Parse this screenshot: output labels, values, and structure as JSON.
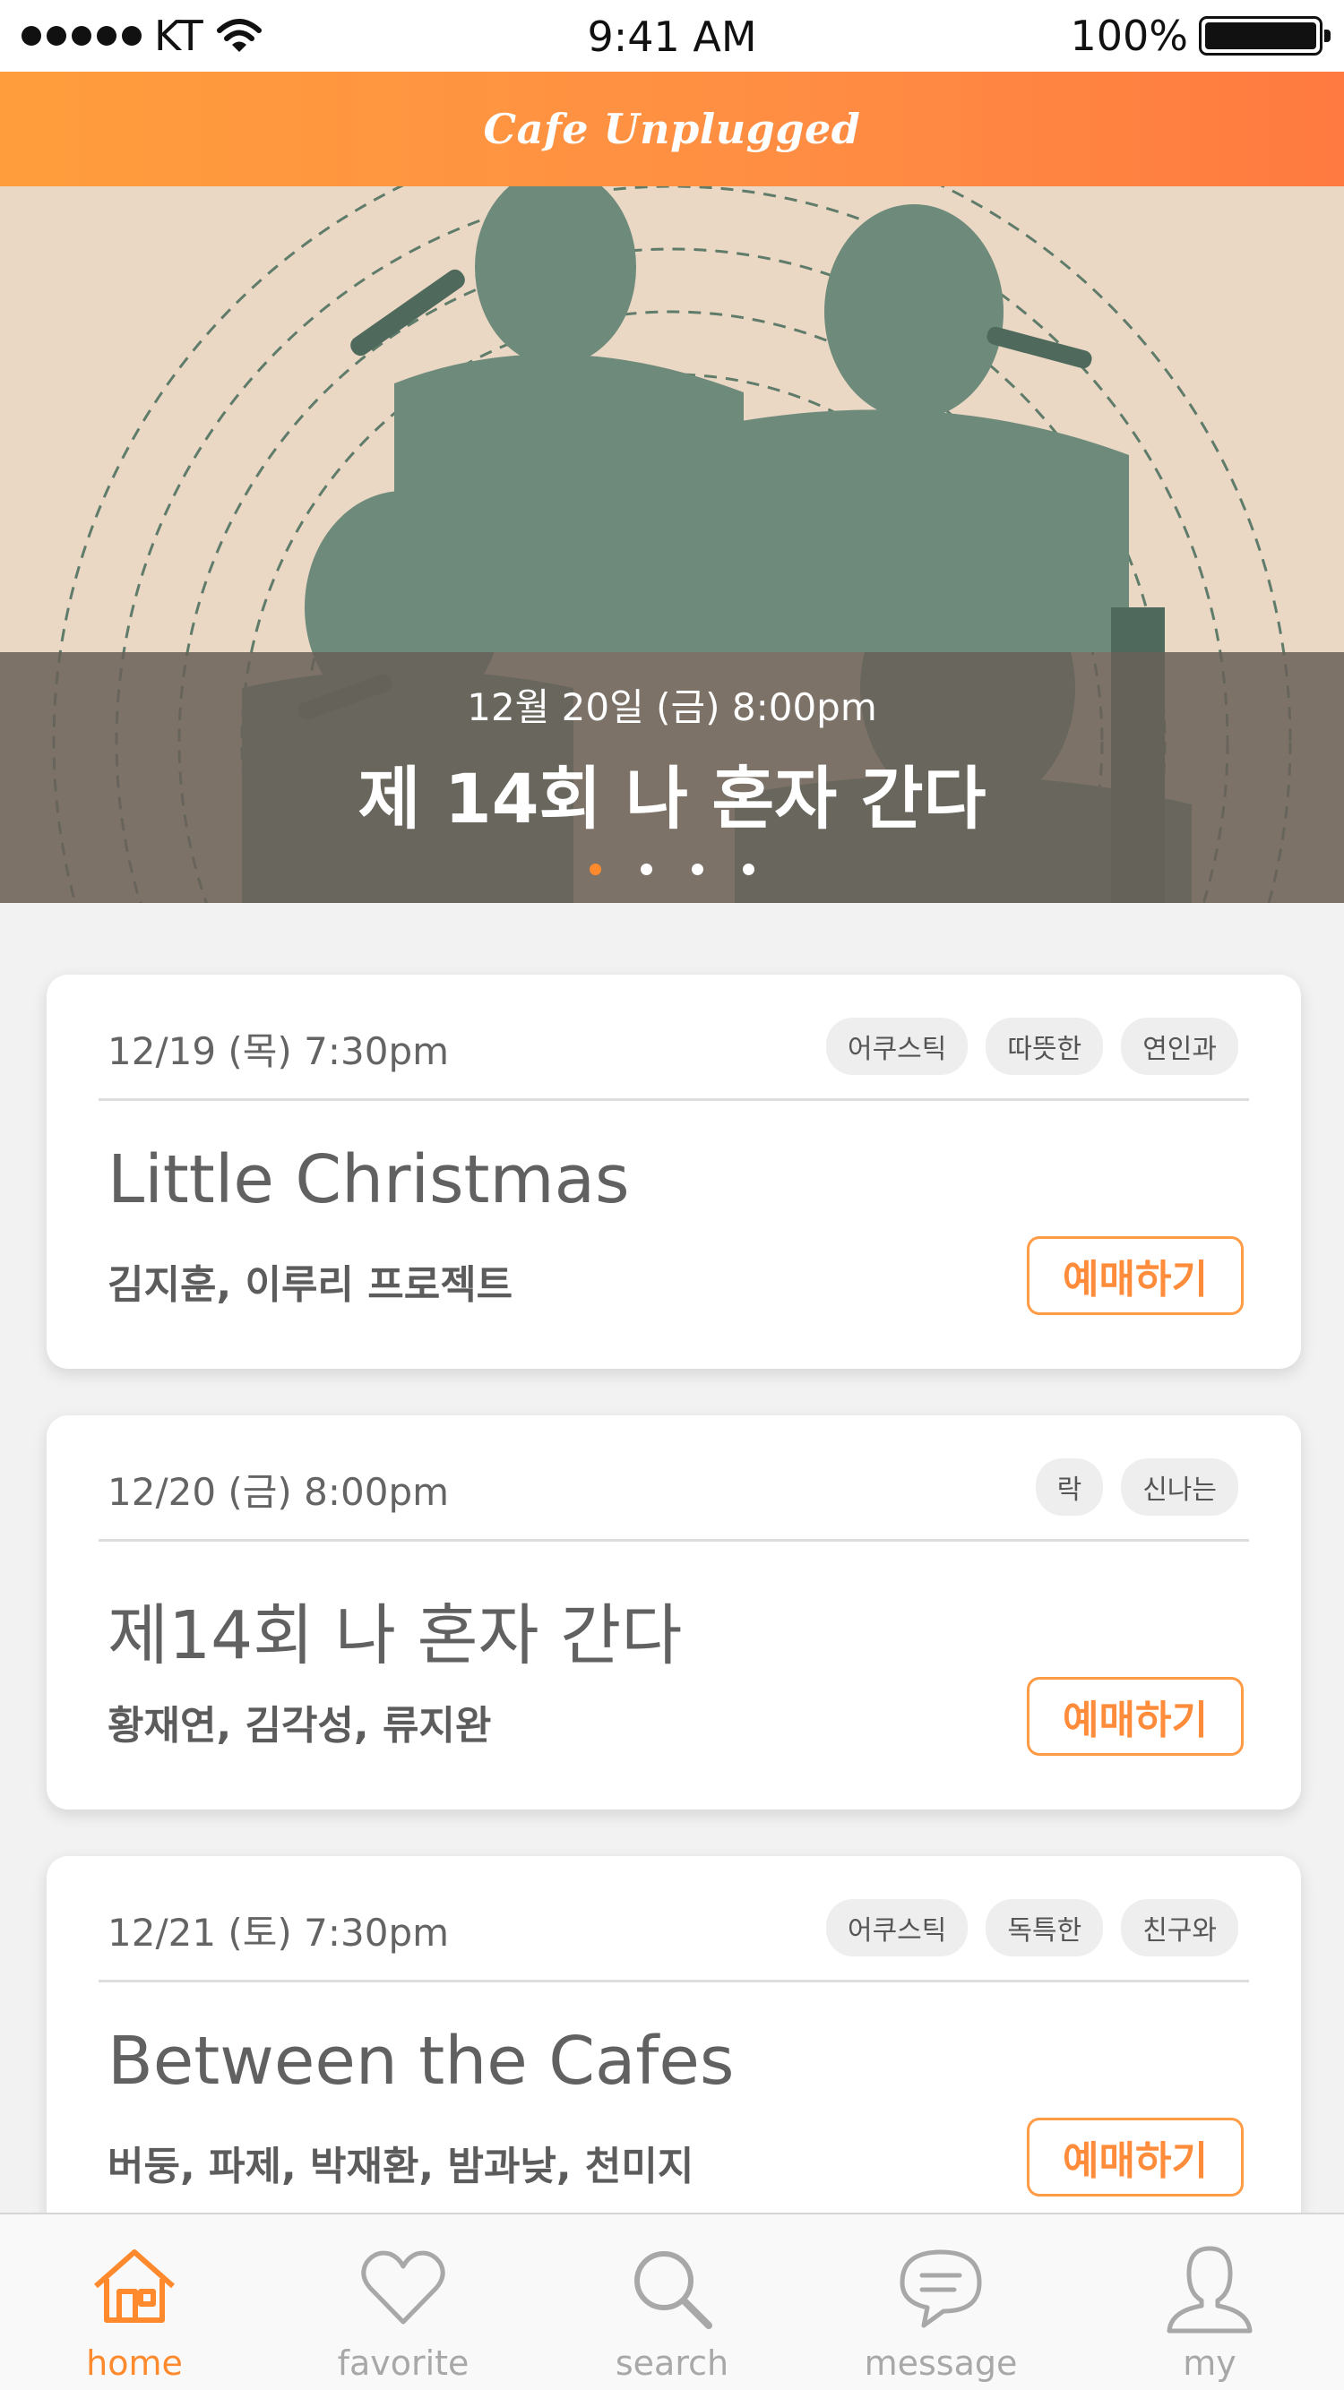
{
  "status_bar": {
    "carrier": "KT",
    "time": "9:41 AM",
    "battery": "100%",
    "battery_level": 1.0
  },
  "header": {
    "title": "Cafe Unplugged",
    "gradient": [
      "#ff9d3c",
      "#ff7a40"
    ]
  },
  "hero": {
    "date": "12월 20일 (금) 8:00pm",
    "title": "제 14회 나 혼자 간다",
    "slide_count": 4,
    "active_slide": 1
  },
  "events": [
    {
      "date": "12/19 (목)  7:30pm",
      "tags": [
        "어쿠스틱",
        "따뜻한",
        "연인과"
      ],
      "title": "Little Christmas",
      "artists": "김지훈, 이루리 프로젝트",
      "button": "예매하기"
    },
    {
      "date": "12/20 (금) 8:00pm",
      "tags": [
        "락",
        "신나는"
      ],
      "title": "제14회 나 혼자 간다",
      "artists": "황재연, 김각성, 류지완",
      "button": "예매하기"
    },
    {
      "date": "12/21 (토) 7:30pm",
      "tags": [
        "어쿠스틱",
        "독특한",
        "친구와"
      ],
      "title": "Between the Cafes",
      "artists": "버둥, 파제, 박재환, 밤과낮, 천미지",
      "button": "예매하기"
    }
  ],
  "tab_bar": {
    "items": [
      {
        "label": "home",
        "icon": "home-icon",
        "active": true
      },
      {
        "label": "favorite",
        "icon": "heart-icon",
        "active": false
      },
      {
        "label": "search",
        "icon": "search-icon",
        "active": false
      },
      {
        "label": "message",
        "icon": "message-icon",
        "active": false
      },
      {
        "label": "my",
        "icon": "profile-icon",
        "active": false
      }
    ]
  },
  "colors": {
    "accent": "#ff8a2e",
    "button_border": "#ff9a45",
    "tab_inactive": "#a8a8a8"
  }
}
